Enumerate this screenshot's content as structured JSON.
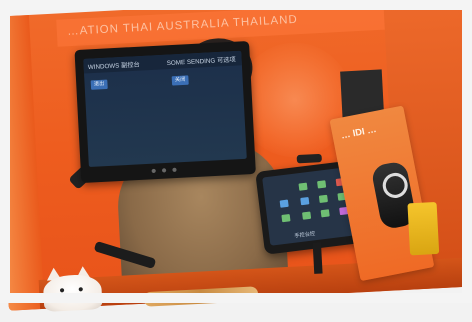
{
  "scene": {
    "booth_banner_text": "…ATION   THAI   AUSTRALIA   THAILAND",
    "colors": {
      "booth_orange": "#ee5d1f",
      "monitor_bezel": "#151515",
      "screen_blue": "#1c2f4a",
      "sign_orange": "#ef6a25"
    }
  },
  "monitor": {
    "left_header": "WINDOWS 副控台",
    "right_header": "SOME SENDING 可选项",
    "left_button": "退出",
    "right_button": "关闭"
  },
  "tablet": {
    "footer_label": "手控台控",
    "tile_colors": [
      "#6fbf73",
      "#6fbf73",
      "#e05a4f",
      "#5aa0e0",
      "#6fbf73",
      "#6fbf73",
      "#6fbf73",
      "#6fbf73",
      "#c36ad8",
      "#5aa0e0",
      "#6fbf73",
      "#6fbf73"
    ]
  },
  "sign": {
    "brand_text": "… IDI …"
  },
  "icons": [
    "cat-figure-icon"
  ]
}
